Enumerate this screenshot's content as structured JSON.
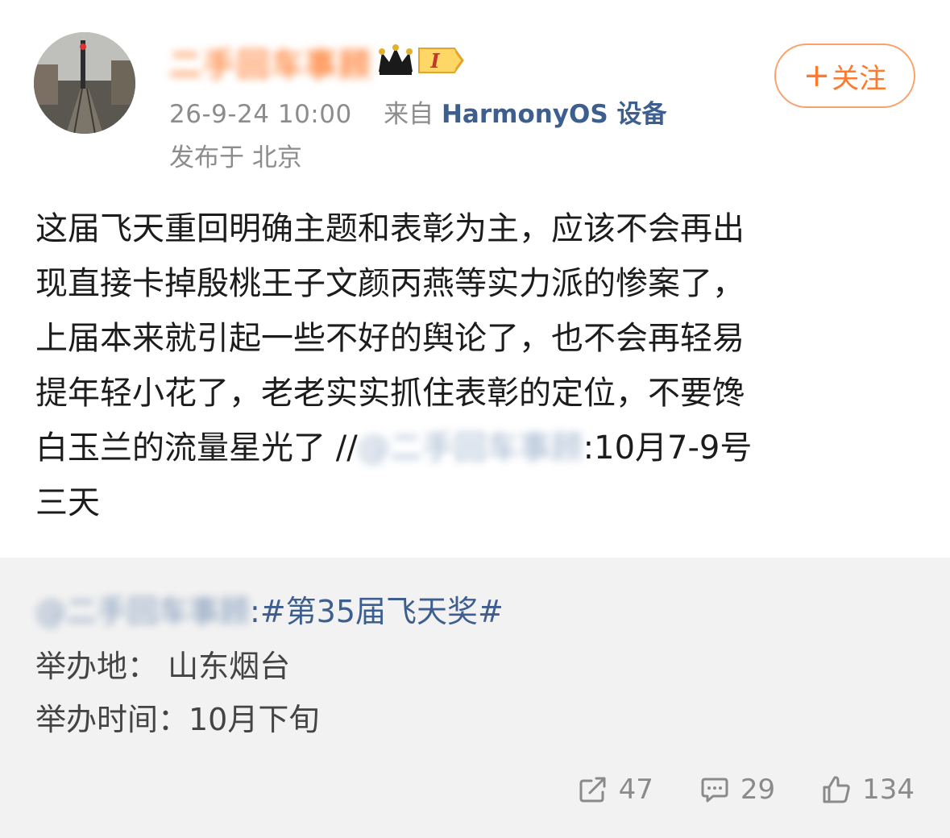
{
  "author": {
    "name": "二手回车事顾",
    "level_badge": "I"
  },
  "meta": {
    "timestamp": "26-9-24 10:00",
    "from_label": "来自",
    "source": "HarmonyOS 设备",
    "location": "发布于 北京"
  },
  "follow_button": {
    "plus": "+",
    "label": "关注"
  },
  "post": {
    "lines": [
      "这届飞天重回明确主题和表彰为主，应该不会再出",
      "现直接卡掉殷桃王子文颜丙燕等实力派的惨案了，",
      "上届本来就引起一些不好的舆论了，也不会再轻易",
      "提年轻小花了，老老实实抓住表彰的定位，不要馋"
    ],
    "line5_prefix": "白玉兰的流量星光了 //",
    "line5_mention": "@二手回车事顾",
    "line5_suffix": ":10月7-9号",
    "line6": "三天"
  },
  "quoted": {
    "mention": "@二手回车事顾",
    "hashtag": ":#第35届飞天奖#",
    "venue": "举办地：   山东烟台",
    "time": "举办时间：10月下旬"
  },
  "stats": {
    "reposts": "47",
    "comments": "29",
    "likes": "134"
  },
  "colors": {
    "accent_orange": "#ff7a2e",
    "link_blue": "#3d5f8f",
    "quote_bg": "#f2f2f2"
  },
  "icons": [
    "avatar-photo",
    "crown-icon",
    "level-badge-icon",
    "share-icon",
    "comment-icon",
    "like-icon"
  ]
}
